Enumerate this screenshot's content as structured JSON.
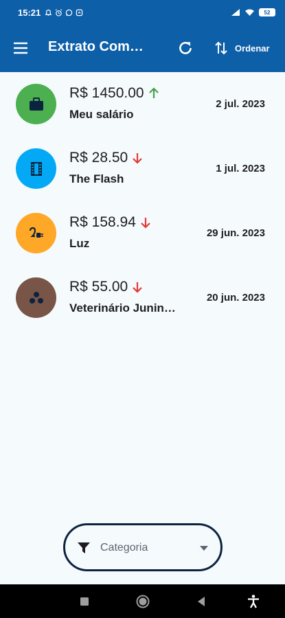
{
  "status_bar": {
    "time": "15:21",
    "notification_icons": [
      "alarm-icon",
      "alarm-clock-icon",
      "whatsapp-icon",
      "messenger-icon"
    ],
    "signal_icons": [
      "signal-icon",
      "wifi-icon"
    ],
    "battery": "52"
  },
  "app_bar": {
    "title": "Extrato Com…",
    "sort_label": "Ordenar",
    "menu_icon": "menu-icon",
    "refresh_icon": "refresh-icon",
    "sort_icon": "swap-vertical-icon",
    "color": "#0d5fa8"
  },
  "transactions": [
    {
      "amount": "R$ 1450.00",
      "direction": "up",
      "name": "Meu salário",
      "date": "2 jul. 2023",
      "icon": "briefcase-icon",
      "color": "#4caf50"
    },
    {
      "amount": "R$ 28.50",
      "direction": "down",
      "name": "The Flash",
      "date": "1 jul. 2023",
      "icon": "film-icon",
      "color": "#03a9f4"
    },
    {
      "amount": "R$ 158.94",
      "direction": "down",
      "name": "Luz",
      "date": "29 jun. 2023",
      "icon": "power-plug-icon",
      "color": "#ffa726"
    },
    {
      "amount": "R$ 55.00",
      "direction": "down",
      "name": "Veterinário Junin…",
      "date": "20 jun. 2023",
      "icon": "paw-icon",
      "color": "#795548"
    }
  ],
  "colors": {
    "up_arrow": "#43a047",
    "down_arrow": "#e53935"
  },
  "filter": {
    "label": "Categoria",
    "icon": "filter-icon",
    "caret_icon": "caret-down-icon"
  },
  "nav_bar": {
    "icons": [
      "recent-apps-icon",
      "home-icon",
      "back-icon",
      "accessibility-icon"
    ]
  }
}
